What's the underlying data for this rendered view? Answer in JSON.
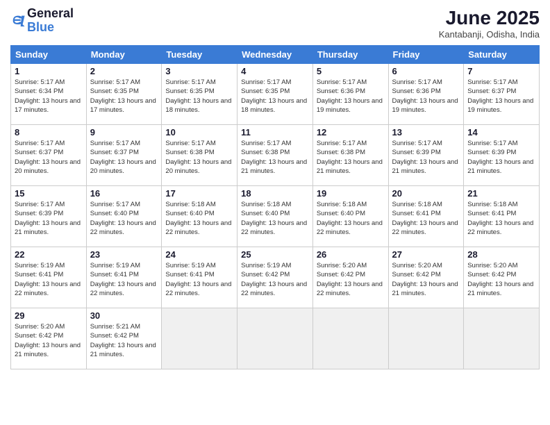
{
  "header": {
    "logo_line1": "General",
    "logo_line2": "Blue",
    "month": "June 2025",
    "location": "Kantabanji, Odisha, India"
  },
  "weekdays": [
    "Sunday",
    "Monday",
    "Tuesday",
    "Wednesday",
    "Thursday",
    "Friday",
    "Saturday"
  ],
  "days": [
    {
      "num": "",
      "empty": true
    },
    {
      "num": "",
      "empty": true
    },
    {
      "num": "",
      "empty": true
    },
    {
      "num": "",
      "empty": true
    },
    {
      "num": "",
      "empty": true
    },
    {
      "num": "",
      "empty": true
    },
    {
      "num": "",
      "empty": true
    },
    {
      "num": "1",
      "rise": "5:17 AM",
      "set": "6:34 PM",
      "hours": "13 hours and 17 minutes"
    },
    {
      "num": "2",
      "rise": "5:17 AM",
      "set": "6:35 PM",
      "hours": "13 hours and 17 minutes"
    },
    {
      "num": "3",
      "rise": "5:17 AM",
      "set": "6:35 PM",
      "hours": "13 hours and 18 minutes"
    },
    {
      "num": "4",
      "rise": "5:17 AM",
      "set": "6:35 PM",
      "hours": "13 hours and 18 minutes"
    },
    {
      "num": "5",
      "rise": "5:17 AM",
      "set": "6:36 PM",
      "hours": "13 hours and 19 minutes"
    },
    {
      "num": "6",
      "rise": "5:17 AM",
      "set": "6:36 PM",
      "hours": "13 hours and 19 minutes"
    },
    {
      "num": "7",
      "rise": "5:17 AM",
      "set": "6:37 PM",
      "hours": "13 hours and 19 minutes"
    },
    {
      "num": "8",
      "rise": "5:17 AM",
      "set": "6:37 PM",
      "hours": "13 hours and 20 minutes"
    },
    {
      "num": "9",
      "rise": "5:17 AM",
      "set": "6:37 PM",
      "hours": "13 hours and 20 minutes"
    },
    {
      "num": "10",
      "rise": "5:17 AM",
      "set": "6:38 PM",
      "hours": "13 hours and 20 minutes"
    },
    {
      "num": "11",
      "rise": "5:17 AM",
      "set": "6:38 PM",
      "hours": "13 hours and 21 minutes"
    },
    {
      "num": "12",
      "rise": "5:17 AM",
      "set": "6:38 PM",
      "hours": "13 hours and 21 minutes"
    },
    {
      "num": "13",
      "rise": "5:17 AM",
      "set": "6:39 PM",
      "hours": "13 hours and 21 minutes"
    },
    {
      "num": "14",
      "rise": "5:17 AM",
      "set": "6:39 PM",
      "hours": "13 hours and 21 minutes"
    },
    {
      "num": "15",
      "rise": "5:17 AM",
      "set": "6:39 PM",
      "hours": "13 hours and 21 minutes"
    },
    {
      "num": "16",
      "rise": "5:17 AM",
      "set": "6:40 PM",
      "hours": "13 hours and 22 minutes"
    },
    {
      "num": "17",
      "rise": "5:18 AM",
      "set": "6:40 PM",
      "hours": "13 hours and 22 minutes"
    },
    {
      "num": "18",
      "rise": "5:18 AM",
      "set": "6:40 PM",
      "hours": "13 hours and 22 minutes"
    },
    {
      "num": "19",
      "rise": "5:18 AM",
      "set": "6:40 PM",
      "hours": "13 hours and 22 minutes"
    },
    {
      "num": "20",
      "rise": "5:18 AM",
      "set": "6:41 PM",
      "hours": "13 hours and 22 minutes"
    },
    {
      "num": "21",
      "rise": "5:18 AM",
      "set": "6:41 PM",
      "hours": "13 hours and 22 minutes"
    },
    {
      "num": "22",
      "rise": "5:19 AM",
      "set": "6:41 PM",
      "hours": "13 hours and 22 minutes"
    },
    {
      "num": "23",
      "rise": "5:19 AM",
      "set": "6:41 PM",
      "hours": "13 hours and 22 minutes"
    },
    {
      "num": "24",
      "rise": "5:19 AM",
      "set": "6:41 PM",
      "hours": "13 hours and 22 minutes"
    },
    {
      "num": "25",
      "rise": "5:19 AM",
      "set": "6:42 PM",
      "hours": "13 hours and 22 minutes"
    },
    {
      "num": "26",
      "rise": "5:20 AM",
      "set": "6:42 PM",
      "hours": "13 hours and 22 minutes"
    },
    {
      "num": "27",
      "rise": "5:20 AM",
      "set": "6:42 PM",
      "hours": "13 hours and 21 minutes"
    },
    {
      "num": "28",
      "rise": "5:20 AM",
      "set": "6:42 PM",
      "hours": "13 hours and 21 minutes"
    },
    {
      "num": "29",
      "rise": "5:20 AM",
      "set": "6:42 PM",
      "hours": "13 hours and 21 minutes"
    },
    {
      "num": "30",
      "rise": "5:21 AM",
      "set": "6:42 PM",
      "hours": "13 hours and 21 minutes"
    },
    {
      "num": "",
      "empty": true
    },
    {
      "num": "",
      "empty": true
    },
    {
      "num": "",
      "empty": true
    },
    {
      "num": "",
      "empty": true
    },
    {
      "num": "",
      "empty": true
    }
  ]
}
